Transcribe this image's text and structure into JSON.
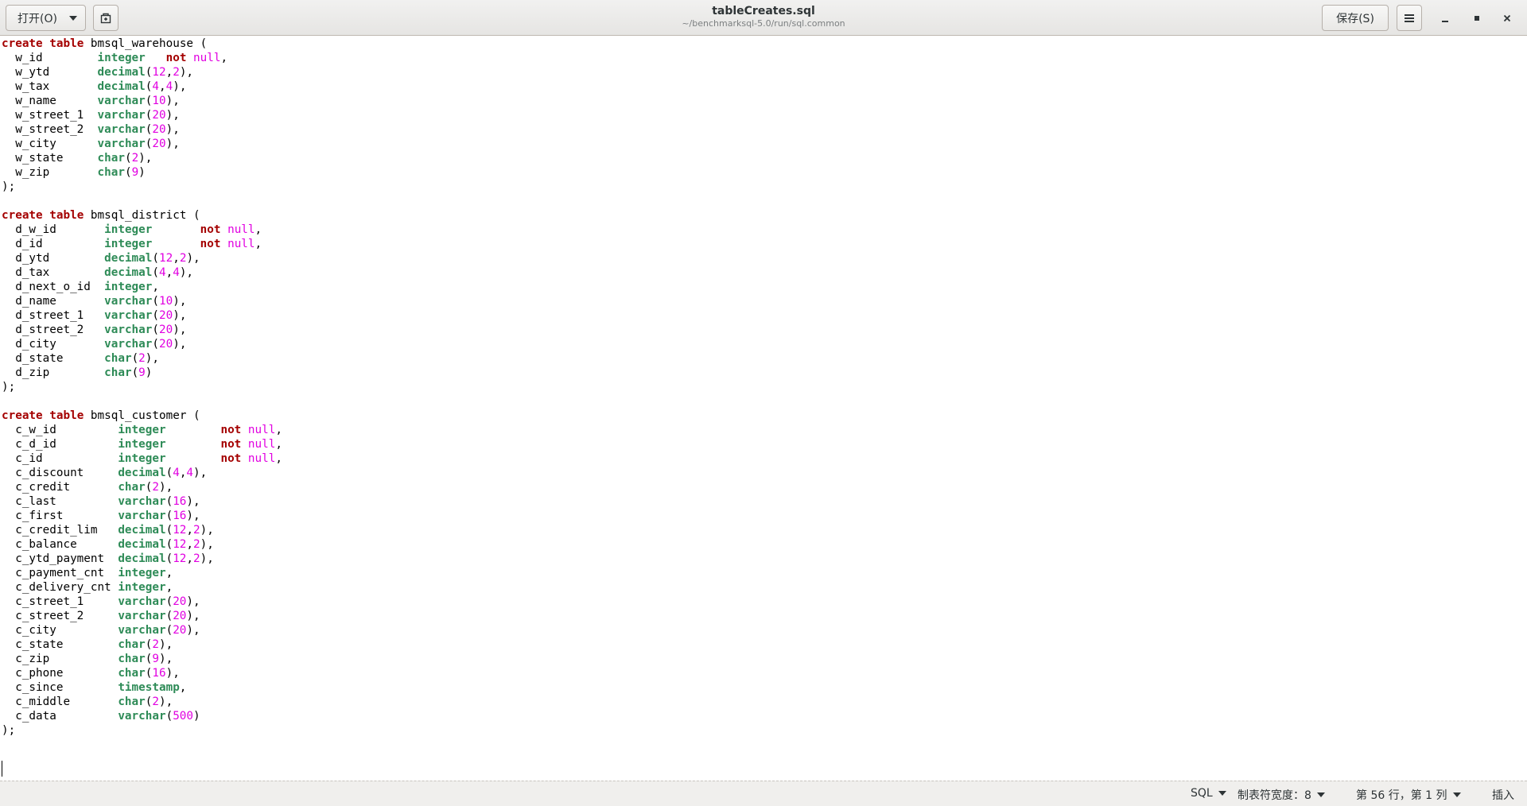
{
  "header": {
    "open_label": "打开(O)",
    "title": "tableCreates.sql",
    "subtitle": "~/benchmarksql-5.0/run/sql.common",
    "save_label": "保存(S)"
  },
  "editor": {
    "lines": [
      "create table bmsql_warehouse (",
      "  w_id        integer   not null,",
      "  w_ytd       decimal(12,2),",
      "  w_tax       decimal(4,4),",
      "  w_name      varchar(10),",
      "  w_street_1  varchar(20),",
      "  w_street_2  varchar(20),",
      "  w_city      varchar(20),",
      "  w_state     char(2),",
      "  w_zip       char(9)",
      ");",
      "",
      "create table bmsql_district (",
      "  d_w_id       integer       not null,",
      "  d_id         integer       not null,",
      "  d_ytd        decimal(12,2),",
      "  d_tax        decimal(4,4),",
      "  d_next_o_id  integer,",
      "  d_name       varchar(10),",
      "  d_street_1   varchar(20),",
      "  d_street_2   varchar(20),",
      "  d_city       varchar(20),",
      "  d_state      char(2),",
      "  d_zip        char(9)",
      ");",
      "",
      "create table bmsql_customer (",
      "  c_w_id         integer        not null,",
      "  c_d_id         integer        not null,",
      "  c_id           integer        not null,",
      "  c_discount     decimal(4,4),",
      "  c_credit       char(2),",
      "  c_last         varchar(16),",
      "  c_first        varchar(16),",
      "  c_credit_lim   decimal(12,2),",
      "  c_balance      decimal(12,2),",
      "  c_ytd_payment  decimal(12,2),",
      "  c_payment_cnt  integer,",
      "  c_delivery_cnt integer,",
      "  c_street_1     varchar(20),",
      "  c_street_2     varchar(20),",
      "  c_city         varchar(20),",
      "  c_state        char(2),",
      "  c_zip          char(9),",
      "  c_phone        char(16),",
      "  c_since        timestamp,",
      "  c_middle       char(2),",
      "  c_data         varchar(500)",
      ");",
      "",
      ""
    ]
  },
  "statusbar": {
    "language": "SQL",
    "tab_width": "制表符宽度：8",
    "position": "第 56 行，第 1 列",
    "mode": "插入"
  },
  "icons": {
    "open_caret": "chevron-down-icon",
    "new_document": "new-document-icon",
    "menu": "hamburger-menu-icon",
    "minimize": "minimize-icon",
    "maximize": "maximize-icon",
    "close": "close-icon"
  },
  "colors": {
    "keyword": "#a40000",
    "type": "#2e8b57",
    "number": "#e100e1"
  }
}
